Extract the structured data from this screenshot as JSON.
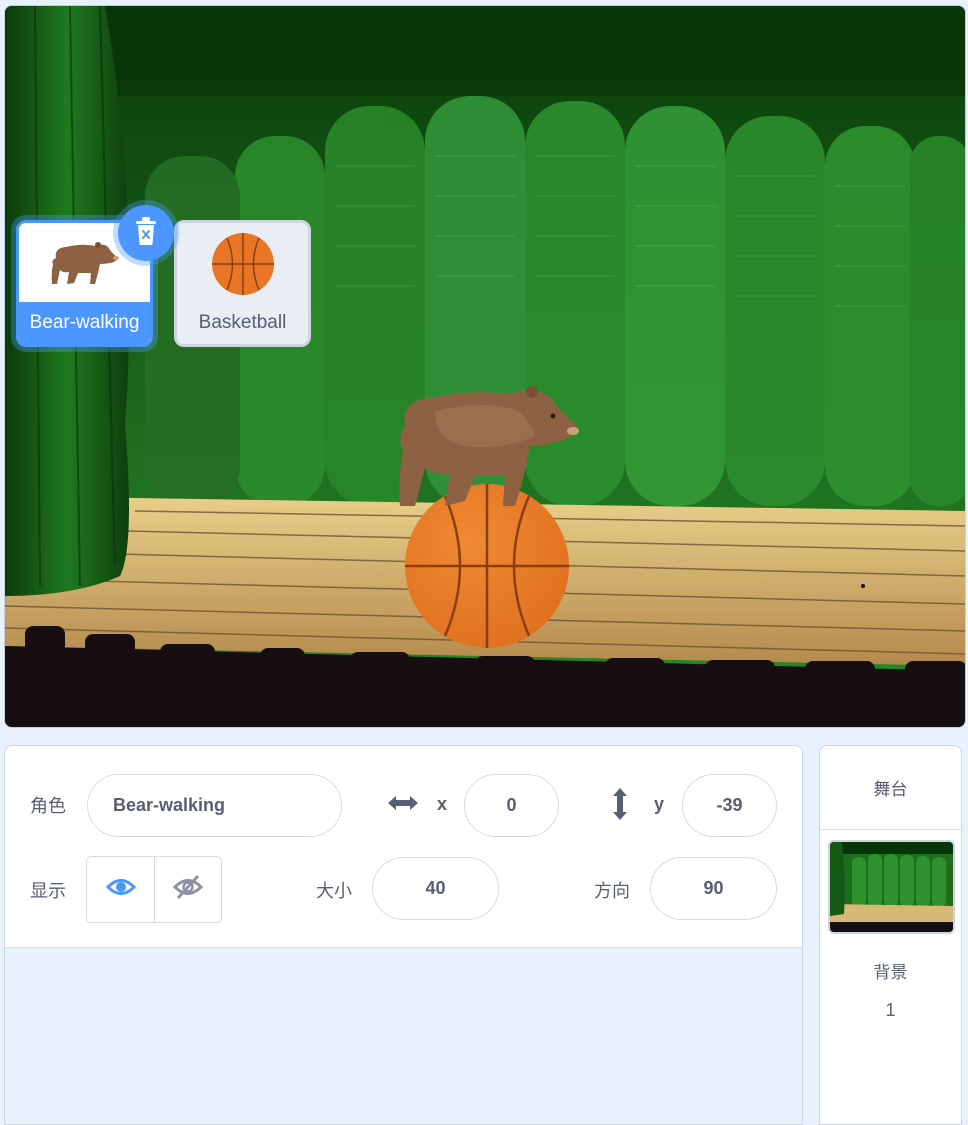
{
  "stage": {
    "backdrop_name": "theater",
    "sprites_on_stage": [
      "bear-walking-icon",
      "basketball-icon"
    ]
  },
  "sprite_info": {
    "sprite_label": "角色",
    "sprite_name": "Bear-walking",
    "x_label": "x",
    "x_value": "0",
    "y_label": "y",
    "y_value": "-39",
    "show_label": "显示",
    "size_label": "大小",
    "size_value": "40",
    "direction_label": "方向",
    "direction_value": "90"
  },
  "sprite_list": [
    {
      "name": "Bear-walking",
      "icon": "bear-icon",
      "selected": true
    },
    {
      "name": "Basketball",
      "icon": "basketball-icon",
      "selected": false
    }
  ],
  "stage_selector": {
    "header": "舞台",
    "backdrop_label": "背景",
    "backdrop_count": "1"
  },
  "colors": {
    "accent": "#4c97ff",
    "text": "#575e75",
    "basketball": "#e87626"
  }
}
